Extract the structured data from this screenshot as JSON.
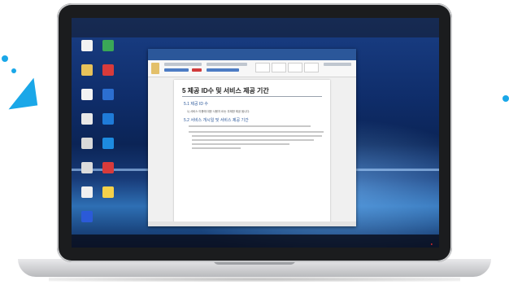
{
  "document": {
    "heading": "5 제공 ID수 및 서비스 제공 기간",
    "section_1": "5.1 제공 ID 수",
    "section_1_text": "1) 서비스 이용에 대한 사용자 ID는 무제한 제공 됩니다.",
    "section_2": "5.2 서비스 개시일 및 서비스 제공 기간"
  },
  "colors": {
    "word_blue": "#2b579a",
    "accent_cyan": "#1aa7e8",
    "tray_red": "#ff2b2b"
  },
  "icons": {
    "desktop": [
      "file-icon",
      "app-icon",
      "explorer-icon",
      "remote-icon",
      "folder-icon"
    ],
    "ribbon": [
      "paste-icon",
      "font-icon",
      "style-icon"
    ]
  }
}
